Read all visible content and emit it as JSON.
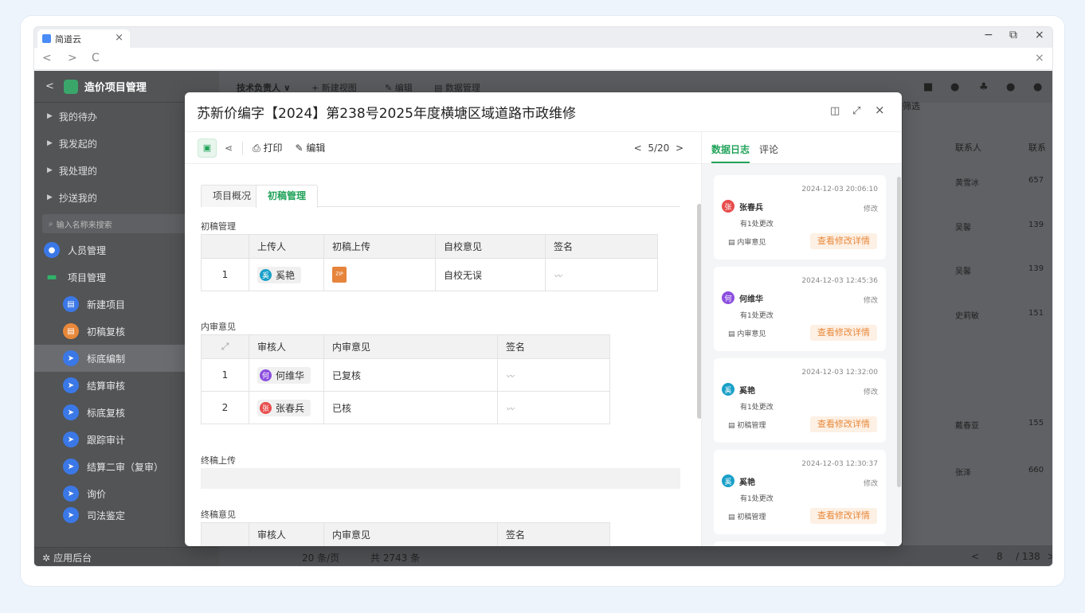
{
  "browser": {
    "tab_title": "简道云",
    "tab_close": "×",
    "win_min": "−",
    "win_restore": "⧉",
    "win_close": "×",
    "nav_back": "<",
    "nav_forward": ">",
    "nav_reload": "C",
    "nav_close": "×"
  },
  "sidebar": {
    "back": "<",
    "title": "造价项目管理",
    "groups": [
      {
        "label": "我的待办"
      },
      {
        "label": "我发起的"
      },
      {
        "label": "我处理的"
      },
      {
        "label": "抄送我的"
      }
    ],
    "search_placeholder": "输入名称来搜索",
    "people": "人员管理",
    "project": "项目管理",
    "children": [
      {
        "label": "新建项目",
        "color": "#3b78e7"
      },
      {
        "label": "初稿复核",
        "color": "#e8883a"
      },
      {
        "label": "标底编制",
        "color": "#3b78e7"
      },
      {
        "label": "结算审核",
        "color": "#3b78e7"
      },
      {
        "label": "标底复核",
        "color": "#3b78e7"
      },
      {
        "label": "跟踪审计",
        "color": "#3b78e7"
      },
      {
        "label": "结算二审（复审）",
        "color": "#3b78e7"
      },
      {
        "label": "询价",
        "color": "#3b78e7"
      },
      {
        "label": "司法鉴定",
        "color": "#3b78e7"
      }
    ],
    "footer": "应用后台"
  },
  "background": {
    "toolbar": {
      "owner": "技术负责人 ∨",
      "new_view": "+ 新建视图",
      "edit": "编辑",
      "data_mgmt": "数据管理"
    },
    "filter": "筛选",
    "columns": [
      "联系人",
      "联系"
    ],
    "rows": [
      {
        "name": "黄雪冰",
        "phone": "657"
      },
      {
        "name": "吴馨",
        "phone": "139"
      },
      {
        "name": "吴馨",
        "phone": "139"
      },
      {
        "name": "史莉敏",
        "phone": "151"
      },
      {
        "name": "戴春亚",
        "phone": "155"
      },
      {
        "name": "张泽",
        "phone": "660"
      }
    ],
    "page_size": "20 条/页",
    "total": "共 2743 条",
    "page": "8",
    "pages": "/ 138"
  },
  "modal": {
    "title": "苏新价编字【2024】第238号2025年度横塘区域道路市政维修",
    "tools": {
      "print": "打印",
      "edit": "编辑",
      "pager": "5/20"
    },
    "tabs": [
      "项目概况",
      "初稿管理"
    ],
    "active_tab": "初稿管理",
    "draft": {
      "title": "初稿管理",
      "headers": [
        "上传人",
        "初稿上传",
        "自校意见",
        "签名"
      ],
      "rows": [
        {
          "no": "1",
          "uploader": "奚艳",
          "avatar": "奚",
          "color": "#1aa0c8",
          "file": "ZIP",
          "opinion": "自校无误"
        }
      ]
    },
    "review": {
      "title": "内审意见",
      "headers": [
        "审核人",
        "内审意见",
        "签名"
      ],
      "rows": [
        {
          "no": "1",
          "reviewer": "何维华",
          "avatar": "何",
          "color": "#8c4fe0",
          "opinion": "已复核"
        },
        {
          "no": "2",
          "reviewer": "张春兵",
          "avatar": "张",
          "color": "#e84c4c",
          "opinion": "已核"
        }
      ]
    },
    "final_upload": "终稿上传",
    "final_review": {
      "title": "终稿意见",
      "headers": [
        "审核人",
        "内审意见",
        "签名"
      ]
    }
  },
  "log": {
    "tabs": [
      "数据日志",
      "评论"
    ],
    "entries": [
      {
        "time": "2024-12-03 20:06:10",
        "user": "张春兵",
        "avatar": "张",
        "color": "#e84c4c",
        "action": "修改",
        "changes": "有1处更改",
        "module": "内审意见",
        "detail": "查看修改详情"
      },
      {
        "time": "2024-12-03 12:45:36",
        "user": "何维华",
        "avatar": "何",
        "color": "#8c4fe0",
        "action": "修改",
        "changes": "有1处更改",
        "module": "内审意见",
        "detail": "查看修改详情"
      },
      {
        "time": "2024-12-03 12:32:00",
        "user": "奚艳",
        "avatar": "奚",
        "color": "#1aa0c8",
        "action": "修改",
        "changes": "有1处更改",
        "module": "初稿管理",
        "detail": "查看修改详情"
      },
      {
        "time": "2024-12-03 12:30:37",
        "user": "奚艳",
        "avatar": "奚",
        "color": "#1aa0c8",
        "action": "修改",
        "changes": "有1处更改",
        "module": "初稿管理",
        "detail": "查看修改详情"
      }
    ]
  },
  "colors": {
    "accent": "#22a35a",
    "detail_bg": "#fdf0e4",
    "detail_text": "#e8883a"
  }
}
